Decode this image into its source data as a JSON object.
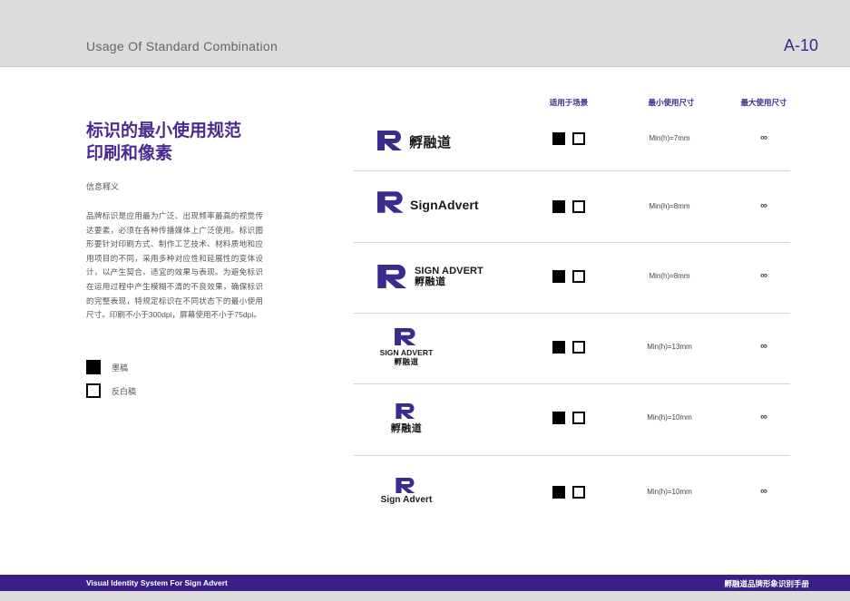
{
  "header": {
    "title": "Usage Of Standard Combination",
    "page_number": "A-10"
  },
  "left": {
    "heading_line1": "标识的最小使用规范",
    "heading_line2": "印刷和像素",
    "subheading": "信息释义",
    "body": "品牌标识是应用最为广泛、出现频率最高的视觉传达要素，必须在各种传播媒体上广泛使用。标识图形要针对印刷方式、制作工艺技术、材料质地和应用项目的不同，采用多种对应性和延展性的变体设计，以产生契合、适宜的效果与表现。为避免标识在运用过程中产生模糊不清的不良效果，确保标识的完整表现，特规定标识在不同状态下的最小使用尺寸。印刷不小于300dpi，屏幕使用不小于75dpi。",
    "legend": [
      {
        "label": "墨稿"
      },
      {
        "label": "反白稿"
      }
    ]
  },
  "columns": {
    "scene": "适用于场景",
    "min": "最小使用尺寸",
    "max": "最大使用尺寸"
  },
  "brand": {
    "name_cn": "孵融道",
    "name_en": "SignAdvert",
    "name_en_spaced": "Sign Advert",
    "name_en_caps": "SIGN ADVERT",
    "color": "#3d2a8f"
  },
  "rows": [
    {
      "min": "Min(h)=7mm",
      "max": "∞"
    },
    {
      "min": "Min(h)=8mm",
      "max": "∞"
    },
    {
      "min": "Min(h)=8mm",
      "max": "∞"
    },
    {
      "min": "Min(h)=13mm",
      "max": "∞"
    },
    {
      "min": "Min(h)=10mm",
      "max": "∞"
    },
    {
      "min": "Min(h)=10mm",
      "max": "∞"
    }
  ],
  "footer": {
    "left": "Visual Identity System For Sign Advert",
    "right": "孵融道品牌形象识别手册"
  }
}
